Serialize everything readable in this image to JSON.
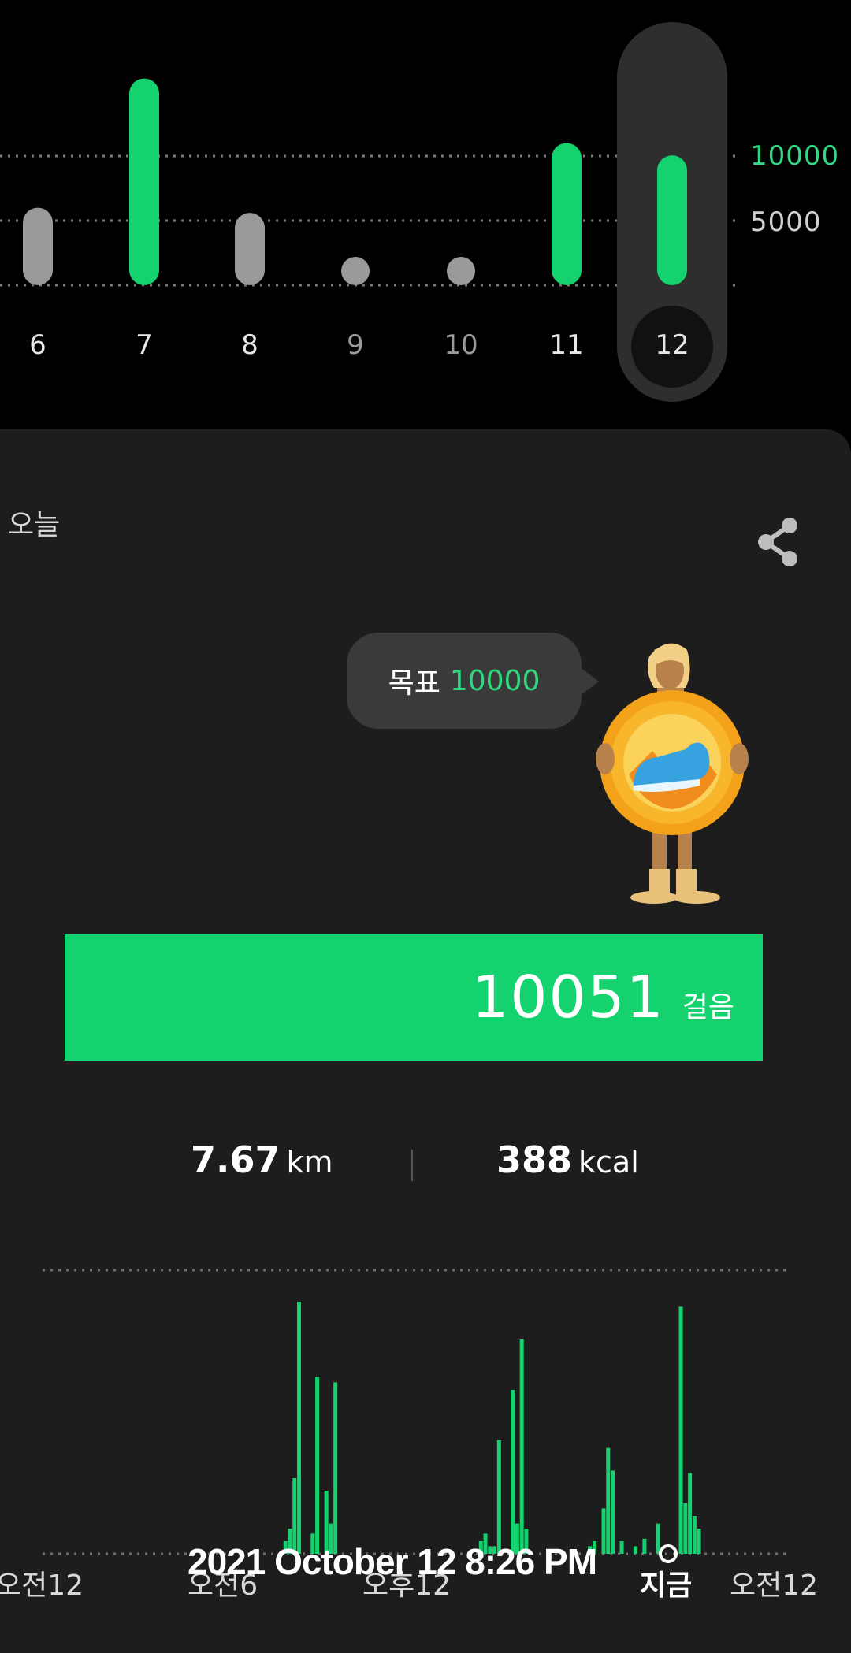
{
  "weekly_chart": {
    "y_axis_labels": [
      {
        "text": "10000",
        "color": "#33d684"
      },
      {
        "text": "5000",
        "color": "#cfcfcf"
      }
    ],
    "days": [
      {
        "label": "6",
        "steps": 6000,
        "goal_met": false
      },
      {
        "label": "7",
        "steps": 16000,
        "goal_met": true
      },
      {
        "label": "8",
        "steps": 5600,
        "goal_met": false
      },
      {
        "label": "9",
        "steps": 0,
        "goal_met": false
      },
      {
        "label": "10",
        "steps": 0,
        "goal_met": false
      },
      {
        "label": "11",
        "steps": 11000,
        "goal_met": true
      },
      {
        "label": "12",
        "steps": 10051,
        "goal_met": true,
        "selected": true
      }
    ],
    "goal": 10000,
    "ylim": [
      0,
      10000
    ]
  },
  "today": {
    "title": "오늘",
    "share_icon": "share-icon",
    "goal_label": "목표",
    "goal_value": "10000",
    "steps": "10051",
    "steps_unit": "걸음",
    "distance": "7.67",
    "distance_unit": "km",
    "calories": "388",
    "calories_unit": "kcal"
  },
  "chart_data": {
    "type": "bar",
    "title": "",
    "xlabel": "",
    "ylabel": "",
    "x_tick_labels": [
      "오전12",
      "오전6",
      "오후12",
      "지금",
      "오전12"
    ],
    "values": [
      0,
      0,
      0,
      0,
      0,
      0,
      0,
      0,
      0,
      0,
      0,
      0,
      0,
      0,
      0,
      0,
      0,
      0,
      0,
      0,
      0,
      0,
      0,
      0,
      0,
      0,
      0,
      0,
      0,
      0,
      0,
      0,
      0,
      0,
      0,
      0,
      0,
      0,
      0,
      0,
      0,
      0,
      0,
      0,
      0,
      0,
      0,
      0,
      0,
      0,
      0,
      0,
      0,
      5,
      10,
      30,
      100,
      0,
      0,
      8,
      70,
      0,
      25,
      12,
      68,
      0,
      0,
      0,
      0,
      0,
      0,
      0,
      0,
      0,
      0,
      0,
      0,
      0,
      0,
      0,
      0,
      0,
      0,
      0,
      0,
      0,
      0,
      0,
      0,
      0,
      0,
      0,
      0,
      0,
      0,
      0,
      5,
      8,
      3,
      3,
      45,
      0,
      0,
      65,
      12,
      85,
      10,
      0,
      0,
      0,
      0,
      0,
      0,
      0,
      0,
      0,
      0,
      0,
      0,
      0,
      3,
      5,
      0,
      18,
      42,
      33,
      0,
      5,
      0,
      0,
      3,
      0,
      6,
      0,
      0,
      12,
      0,
      0,
      0,
      0,
      98,
      20,
      32,
      15,
      10,
      0,
      0,
      0,
      0,
      0,
      0,
      0,
      0,
      0,
      0,
      0,
      0,
      0,
      0,
      0,
      0,
      0,
      0,
      0
    ],
    "colors": {
      "bar": "#14d26d",
      "grid": "#6e6e6e"
    }
  },
  "status_overlay": {
    "timestamp": "2021 October 12 8:26 PM"
  }
}
